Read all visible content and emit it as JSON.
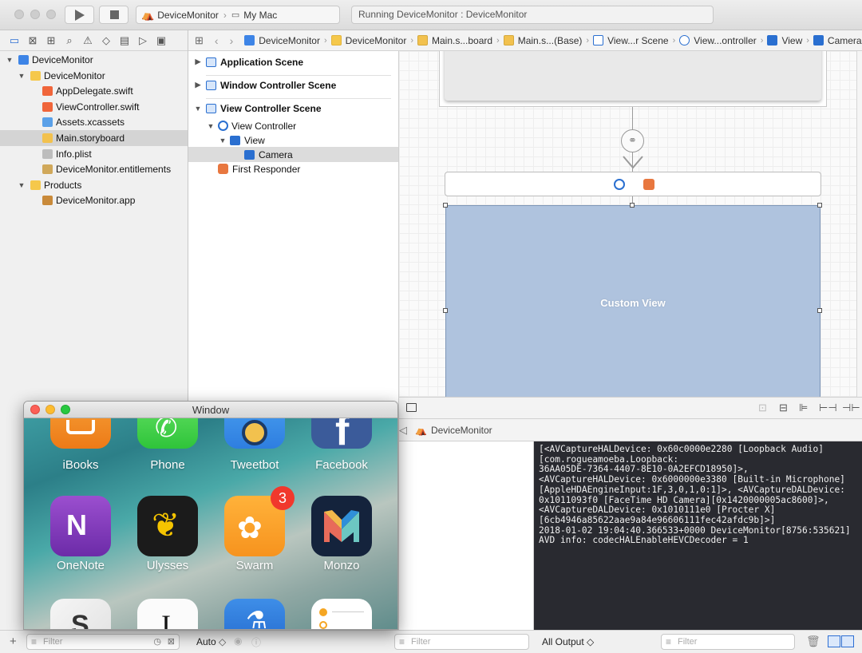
{
  "toolbar": {
    "scheme_project": "DeviceMonitor",
    "scheme_destination": "My Mac",
    "activity_status": "Running DeviceMonitor : DeviceMonitor"
  },
  "navigator": {
    "items": [
      {
        "label": "DeviceMonitor",
        "level": 0,
        "disclosure": "▼",
        "icon": "project-icon"
      },
      {
        "label": "DeviceMonitor",
        "level": 1,
        "disclosure": "▼",
        "icon": "folder-icon"
      },
      {
        "label": "AppDelegate.swift",
        "level": 2,
        "disclosure": "",
        "icon": "swift-file-icon"
      },
      {
        "label": "ViewController.swift",
        "level": 2,
        "disclosure": "",
        "icon": "swift-file-icon"
      },
      {
        "label": "Assets.xcassets",
        "level": 2,
        "disclosure": "",
        "icon": "assets-icon"
      },
      {
        "label": "Main.storyboard",
        "level": 2,
        "disclosure": "",
        "icon": "storyboard-icon",
        "selected": true
      },
      {
        "label": "Info.plist",
        "level": 2,
        "disclosure": "",
        "icon": "plist-icon"
      },
      {
        "label": "DeviceMonitor.entitlements",
        "level": 2,
        "disclosure": "",
        "icon": "entitlements-icon"
      },
      {
        "label": "Products",
        "level": 1,
        "disclosure": "▼",
        "icon": "folder-icon"
      },
      {
        "label": "DeviceMonitor.app",
        "level": 2,
        "disclosure": "",
        "icon": "app-icon"
      }
    ],
    "filter_placeholder": "Filter"
  },
  "jumpbar": {
    "crumbs": [
      "DeviceMonitor",
      "DeviceMonitor",
      "Main.s...board",
      "Main.s...(Base)",
      "View...r Scene",
      "View...ontroller",
      "View",
      "Camera"
    ]
  },
  "outline": {
    "application_scene": "Application Scene",
    "window_controller_scene": "Window Controller Scene",
    "view_controller_scene": "View Controller Scene",
    "view_controller": "View Controller",
    "view": "View",
    "camera": "Camera",
    "first_responder": "First Responder",
    "auto_label": "Auto"
  },
  "canvas": {
    "custom_view_label": "Custom View"
  },
  "debug": {
    "process_name": "DeviceMonitor",
    "console_text": "[<AVCaptureHALDevice: 0x60c0000e2280 [Loopback Audio]\n[com.rogueamoeba.Loopback:\n36AA05DE-7364-4407-8E10-0A2EFCD18950]>,\n<AVCaptureHALDevice: 0x6000000e3380 [Built-in Microphone]\n[AppleHDAEngineInput:1F,3,0,1,0:1]>, <AVCaptureDALDevice:\n0x1011093f0 [FaceTime HD Camera][0x1420000005ac8600]>,\n<AVCaptureDALDevice: 0x1010111e0 [Procter X]\n[6cb4946a85622aae9a84e96606111fec42afdc9b]>]\n2018-01-02 19:04:40.366533+0000 DeviceMonitor[8756:535621]\nAVD info: codecHALEnableHEVCDecoder = 1",
    "output_selector": "All Output ◇",
    "filter_placeholder": "Filter"
  },
  "simulator": {
    "title": "Window",
    "apps_row1": [
      "iBooks",
      "Phone",
      "Tweetbot",
      "Facebook"
    ],
    "apps_row2": [
      "OneNote",
      "Ulysses",
      "Swarm",
      "Monzo"
    ],
    "swarm_badge": "3"
  },
  "colors": {
    "selection": "#d4d4d4",
    "accent": "#2d6fd3",
    "console_bg": "#292a30",
    "custom_view": "#afc3de"
  }
}
